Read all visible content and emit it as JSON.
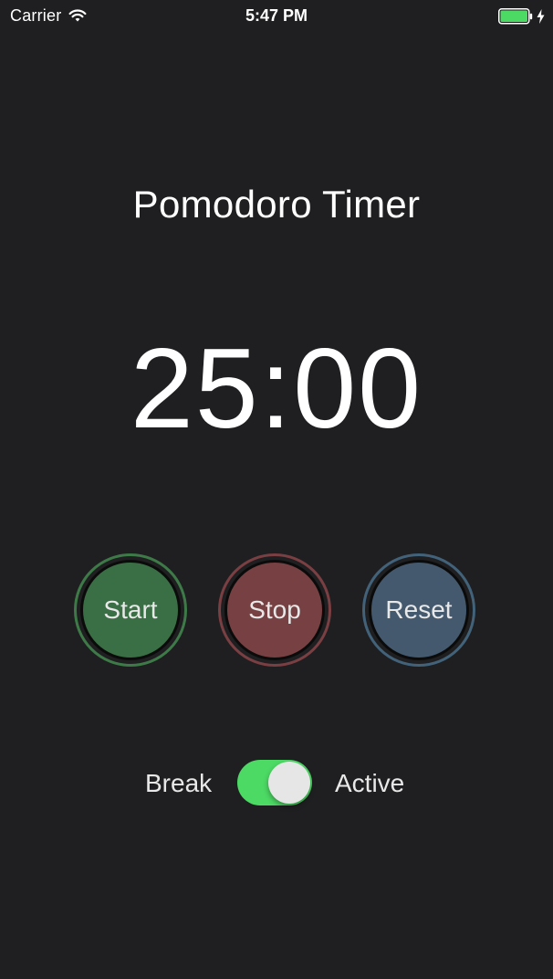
{
  "status_bar": {
    "carrier": "Carrier",
    "time": "5:47 PM",
    "wifi_icon": "wifi-icon",
    "battery_icon": "battery-full-icon",
    "charging_icon": "charging-bolt-icon",
    "battery_color": "#4cd964"
  },
  "title": "Pomodoro Timer",
  "timer": {
    "display": "25:00"
  },
  "buttons": {
    "start": {
      "label": "Start",
      "color": "#3a6e45"
    },
    "stop": {
      "label": "Stop",
      "color": "#774042"
    },
    "reset": {
      "label": "Reset",
      "color": "#44596e"
    }
  },
  "mode_toggle": {
    "left_label": "Break",
    "right_label": "Active",
    "is_on": true,
    "on_color": "#4cd964"
  },
  "colors": {
    "background": "#1f1f21",
    "text": "#ffffff"
  }
}
